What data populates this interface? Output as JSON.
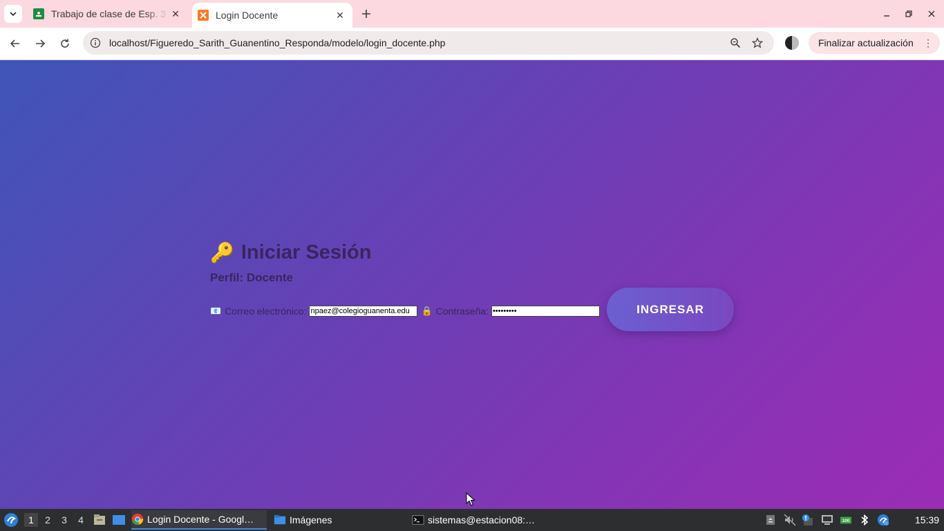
{
  "browser": {
    "tabs": [
      {
        "title": "Trabajo de clase de Esp. 3",
        "active": false
      },
      {
        "title": "Login Docente",
        "active": true
      }
    ],
    "url": "localhost/Figueredo_Sarith_Guanentino_Responda/modelo/login_docente.php",
    "update_button": "Finalizar actualización"
  },
  "page": {
    "title": "Iniciar Sesión",
    "profile": "Perfil: Docente",
    "email_label": "Correo electrónico:",
    "email_value": "npaez@colegioguanenta.edu",
    "password_label": "Contraseña:",
    "password_value": "•••••••••",
    "submit_label": "INGRESAR"
  },
  "taskbar": {
    "workspaces": [
      "1",
      "2",
      "3",
      "4"
    ],
    "tasks": [
      {
        "label": "Login Docente - Googl…",
        "icon": "chrome-icon",
        "active": true
      },
      {
        "label": "Imágenes",
        "icon": "folder-icon",
        "active": false
      },
      {
        "label": "sistemas@estacion08:…",
        "icon": "terminal-icon",
        "active": false
      }
    ],
    "clock": "15:39"
  },
  "colors": {
    "page_gradient_start": "#3f55b8",
    "page_gradient_end": "#9c2cb5",
    "tabstrip": "#fcd9e0",
    "taskbar": "#2d2e30"
  }
}
